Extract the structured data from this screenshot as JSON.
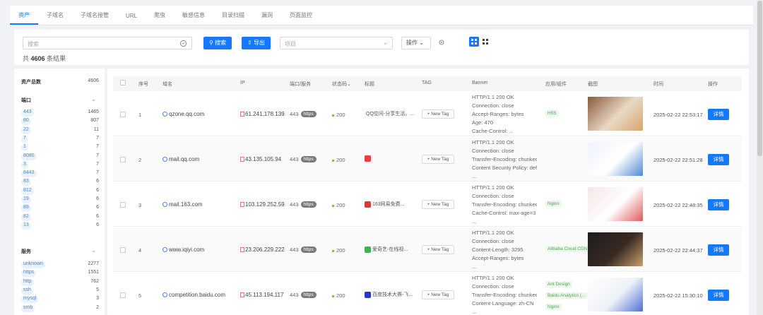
{
  "tabs": [
    {
      "label": "资产"
    },
    {
      "label": "子域名"
    },
    {
      "label": "子域名接管"
    },
    {
      "label": "URL"
    },
    {
      "label": "爬虫"
    },
    {
      "label": "敏感信息"
    },
    {
      "label": "目录扫描"
    },
    {
      "label": "漏洞"
    },
    {
      "label": "页面监控"
    }
  ],
  "toolbar": {
    "search_placeholder": "搜索",
    "search_button": "搜索",
    "export_button": "导出",
    "project_placeholder": "项目",
    "operation_label": "操作",
    "result_prefix": "共",
    "result_count": "4606",
    "result_suffix": "条结果"
  },
  "sidebar": {
    "total_label": "资产总数",
    "total_value": "4606",
    "port_title": "端口",
    "ports": [
      {
        "k": "443",
        "v": "1465"
      },
      {
        "k": "80",
        "v": "807"
      },
      {
        "k": "22",
        "v": "11"
      },
      {
        "k": "7",
        "v": "7"
      },
      {
        "k": "1",
        "v": "7"
      },
      {
        "k": "8080",
        "v": "7"
      },
      {
        "k": "3",
        "v": "7"
      },
      {
        "k": "8443",
        "v": "7"
      },
      {
        "k": "83",
        "v": "6"
      },
      {
        "k": "812",
        "v": "6"
      },
      {
        "k": "19",
        "v": "6"
      },
      {
        "k": "89",
        "v": "6"
      },
      {
        "k": "82",
        "v": "6"
      },
      {
        "k": "13",
        "v": "6"
      }
    ],
    "service_title": "服务",
    "services": [
      {
        "k": "unknown",
        "v": "2277"
      },
      {
        "k": "https",
        "v": "1551"
      },
      {
        "k": "http",
        "v": "762"
      },
      {
        "k": "ssh",
        "v": "5"
      },
      {
        "k": "mysql",
        "v": "3"
      },
      {
        "k": "smb",
        "v": "2"
      }
    ]
  },
  "table": {
    "headers": [
      "序号",
      "域名",
      "IP",
      "端口/服务",
      "状态码",
      "标题",
      "TAG",
      "Banner",
      "应用/组件",
      "截图",
      "时间",
      "操作"
    ],
    "new_tag_label": "+ New Tag",
    "detail_label": "详情",
    "rows": [
      {
        "no": "1",
        "domain": "qzone.qq.com",
        "ip": "61.241.178.139",
        "port": "443",
        "service": "https",
        "status": "200",
        "title": "QQ空间-分享生活，...",
        "favicon_color": "#f2c23a",
        "banner": [
          "HTTP/1.1 200 OK",
          "Connection: close",
          "Accept-Ranges: bytes",
          "Age: 470",
          "Cache-Control: ..."
        ],
        "apps": [
          "H5S"
        ],
        "time": "2025-02-22 22:53:17",
        "shot_colors": [
          "#8a5a3a",
          "#e9d9c5",
          "#d6a36f"
        ]
      },
      {
        "no": "2",
        "domain": "mail.qq.com",
        "ip": "43.135.105.94",
        "port": "443",
        "service": "https",
        "status": "200",
        "title": "",
        "favicon_color": "#e0433b",
        "banner": [
          "HTTP/1.1 200 OK",
          "Connection: close",
          "Transfer-Encoding: chunked",
          "Content Security Policy: default",
          "..."
        ],
        "apps": [],
        "time": "2025-02-22 22:51:28",
        "shot_colors": [
          "#eef4fb",
          "#ffffff",
          "#4f89d6"
        ]
      },
      {
        "no": "3",
        "domain": "mail.163.com",
        "ip": "103.129.252.59",
        "port": "443",
        "service": "https",
        "status": "200",
        "title": "163网易免费...",
        "favicon_color": "#d93a35",
        "banner": [
          "HTTP/1.1 200 OK",
          "Connection: close",
          "Transfer-Encoding: chunked",
          "Cache-Control: max-age=3",
          "..."
        ],
        "apps": [
          "Nginx"
        ],
        "time": "2025-02-22 22:48:35",
        "shot_colors": [
          "#f6e6e6",
          "#ffffff",
          "#e05a5a"
        ]
      },
      {
        "no": "4",
        "domain": "www.iqiyi.com",
        "ip": "23.206.229.222",
        "port": "443",
        "service": "https",
        "status": "200",
        "title": "爱奇艺-在线视...",
        "favicon_color": "#3fb24a",
        "banner": [
          "HTTP/1.1 200 OK",
          "Connection: close",
          "Content-Length: 3295",
          "Accept-Ranges: bytes",
          "..."
        ],
        "apps": [
          "Alibaba Cloud CDN"
        ],
        "time": "2025-02-22 22:44:37",
        "shot_colors": [
          "#1c1c1c",
          "#3a2a22",
          "#c9a071"
        ]
      },
      {
        "no": "5",
        "domain": "competition.baidu.com",
        "ip": "45.113.194.117",
        "port": "443",
        "service": "https",
        "status": "200",
        "title": "百度技术大赛-飞...",
        "favicon_color": "#2a37c9",
        "banner": [
          "HTTP/1.1 200 OK",
          "Connection: close",
          "Transfer-Encoding: chunked",
          "Content-Language: zh-CN",
          "..."
        ],
        "apps": [
          "Ant Design",
          "Baidu Analytics (...",
          "Nginx"
        ],
        "time": "2025-02-22 15:30:10",
        "shot_colors": [
          "#ffffff",
          "#eef2f8",
          "#4f6fd6"
        ]
      }
    ]
  },
  "colors": {
    "accent": "#1677ff",
    "status_ok": "#52c41a"
  }
}
